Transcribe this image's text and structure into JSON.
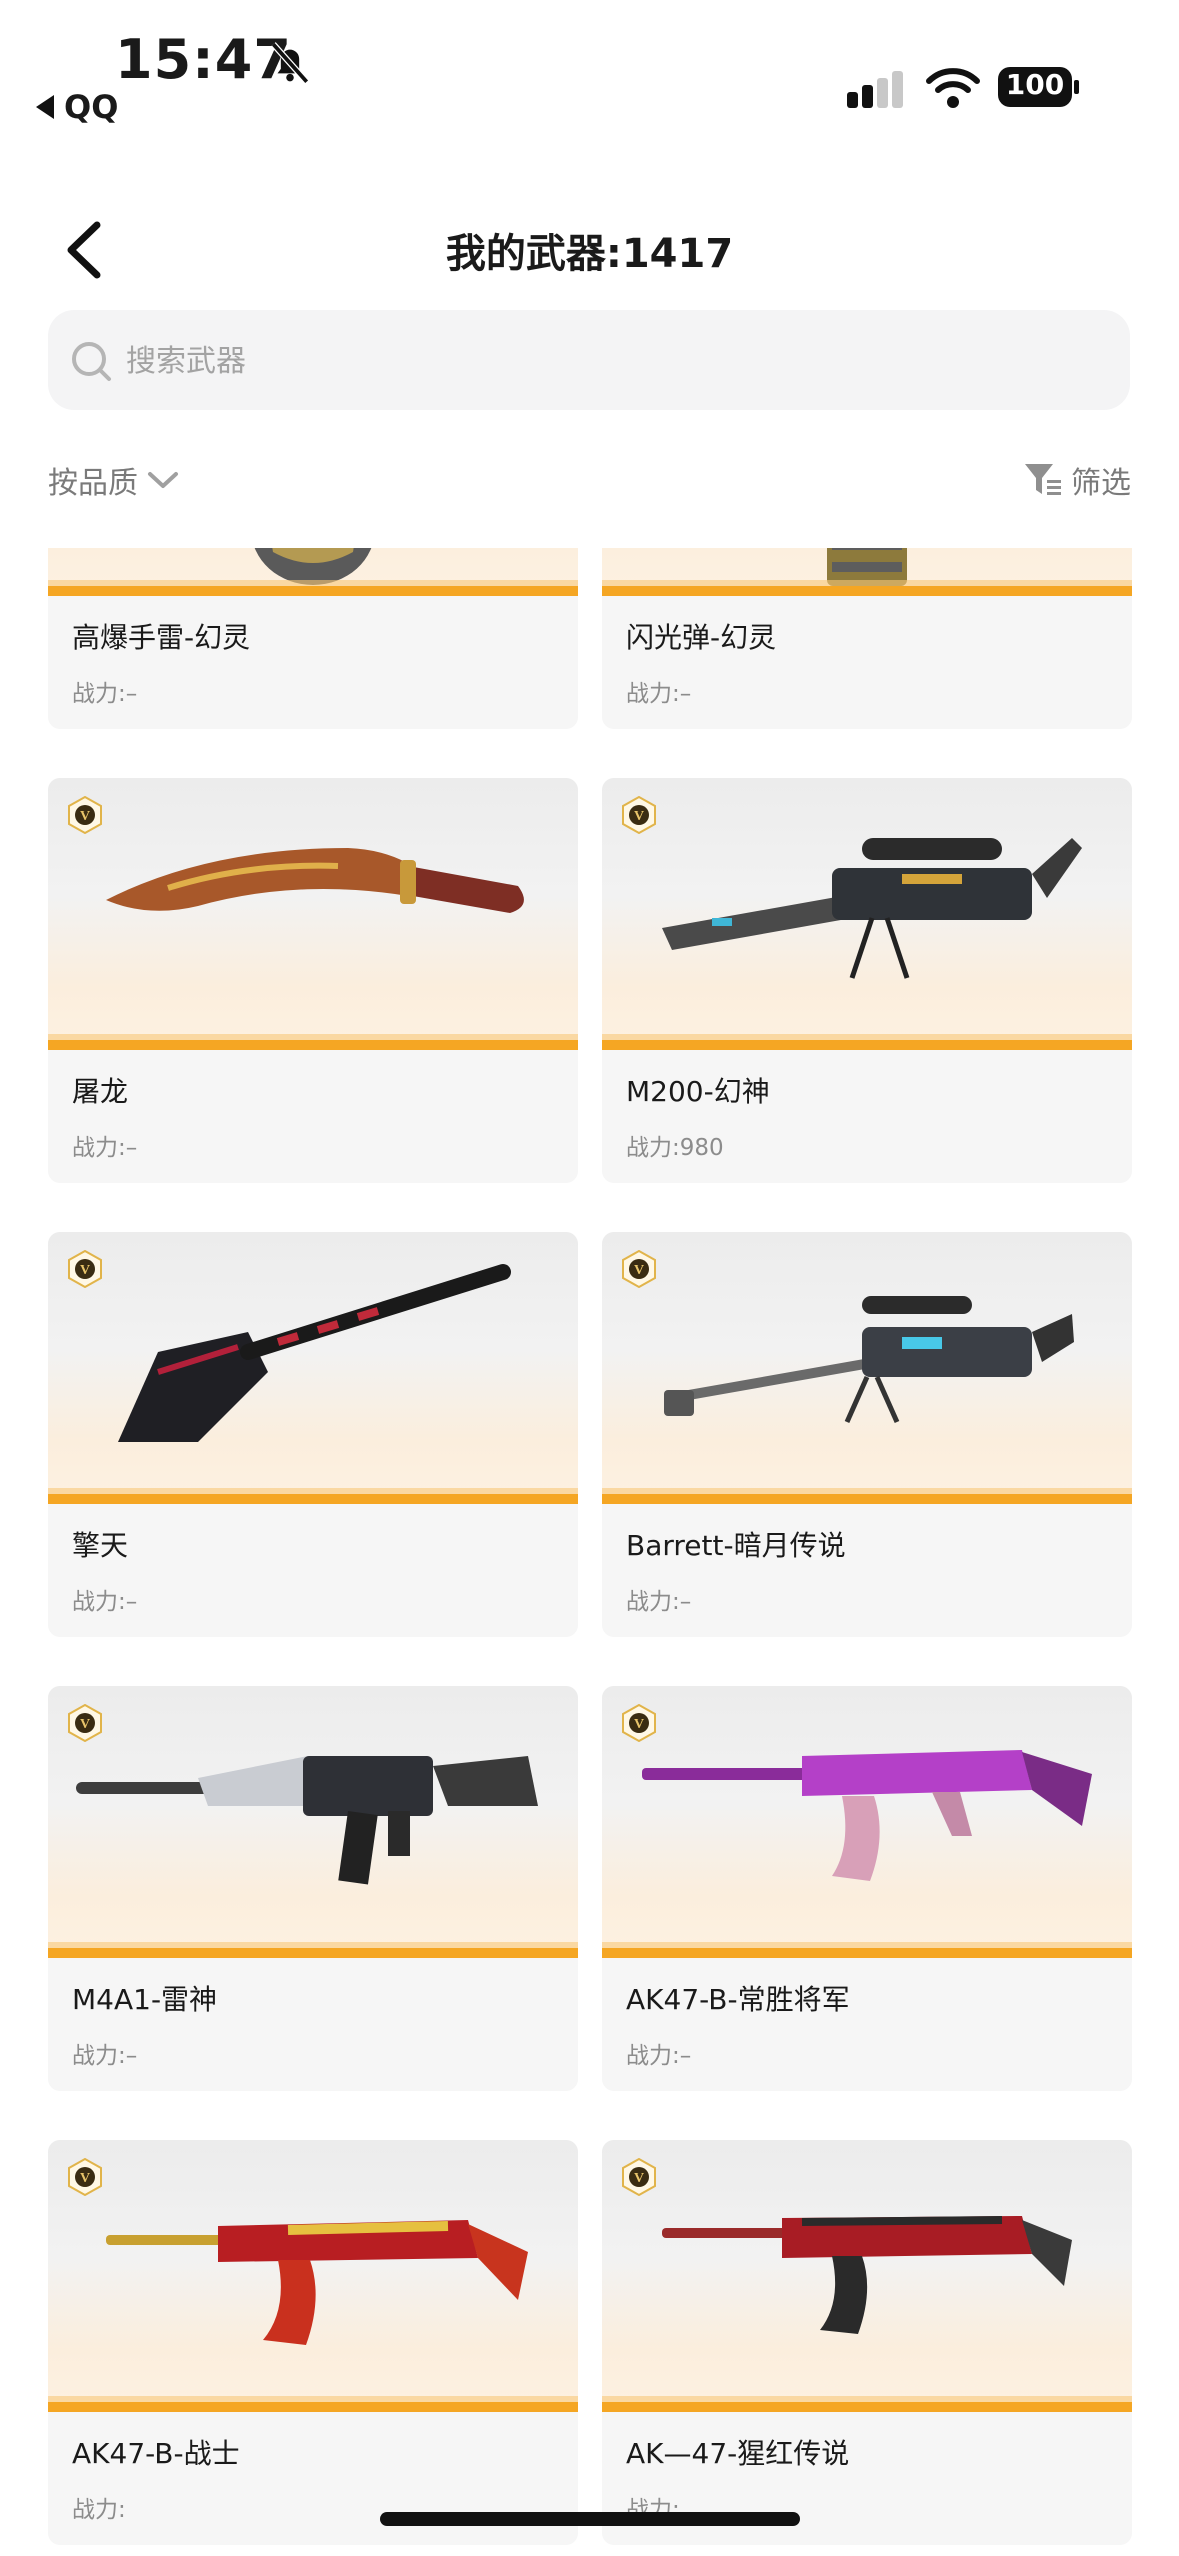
{
  "status_bar": {
    "time": "15:47",
    "back_app": "QQ",
    "battery": "100"
  },
  "header": {
    "title": "我的武器:1417"
  },
  "search": {
    "placeholder": "搜索武器"
  },
  "toolbar": {
    "sort_label": "按品质",
    "filter_label": "筛选"
  },
  "cards": [
    {
      "name": "高爆手雷-幻灵",
      "power_label": "战力:",
      "power": "–",
      "icon": "grenade"
    },
    {
      "name": "闪光弹-幻灵",
      "power_label": "战力:",
      "power": "–",
      "icon": "flashbang"
    },
    {
      "name": "屠龙",
      "power_label": "战力:",
      "power": "–",
      "icon": "kukri-knife"
    },
    {
      "name": "M200-幻神",
      "power_label": "战力:",
      "power": "980",
      "icon": "sniper-rifle"
    },
    {
      "name": "擎天",
      "power_label": "战力:",
      "power": "–",
      "icon": "shovel"
    },
    {
      "name": "Barrett-暗月传说",
      "power_label": "战力:",
      "power": "–",
      "icon": "barrett-rifle"
    },
    {
      "name": "M4A1-雷神",
      "power_label": "战力:",
      "power": "–",
      "icon": "m4a1-rifle"
    },
    {
      "name": "AK47-B-常胜将军",
      "power_label": "战力:",
      "power": "–",
      "icon": "ak47-rifle"
    },
    {
      "name": "AK47-B-战士",
      "power_label": "战力:",
      "power": "",
      "icon": "ak47-rifle"
    },
    {
      "name": "AK—47-猩红传说",
      "power_label": "战力:",
      "power": "",
      "icon": "ak47-rifle"
    }
  ],
  "colors": {
    "accent_bar": "#f5a623",
    "card_bg": "#f6f6f6",
    "muted_text": "#8c8c8c"
  }
}
